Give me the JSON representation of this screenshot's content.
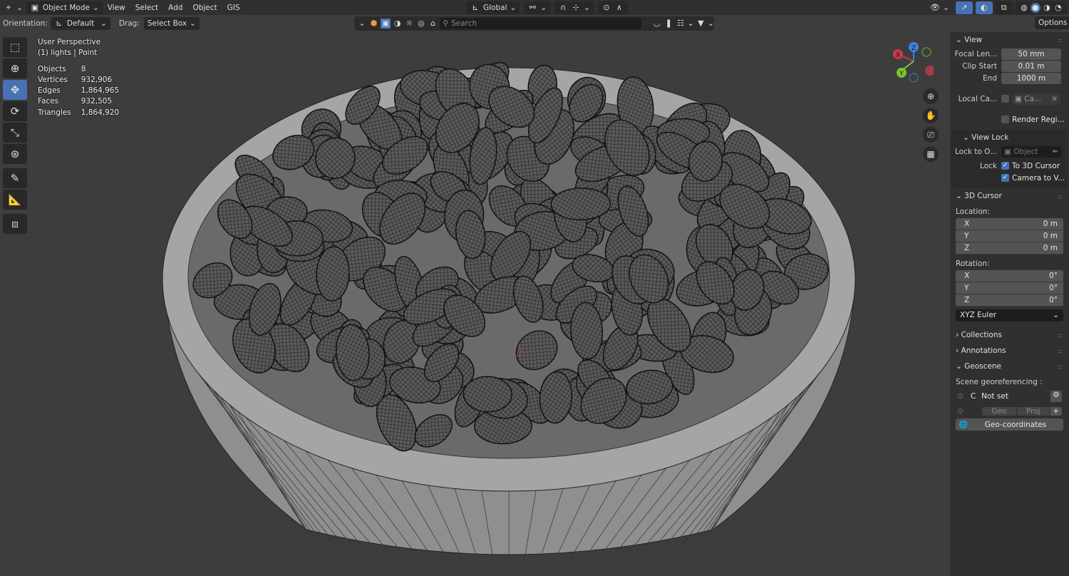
{
  "header": {
    "mode": "Object Mode",
    "menus": [
      "View",
      "Select",
      "Add",
      "Object",
      "GIS"
    ],
    "orientation_transform": "Global"
  },
  "tool_header": {
    "orientation_label": "Orientation:",
    "orientation_value": "Default",
    "drag_label": "Drag:",
    "drag_value": "Select Box",
    "search_placeholder": "Search",
    "options_label": "Options"
  },
  "overlay": {
    "view_name": "User Perspective",
    "context": "(1) lights | Point",
    "stats": [
      {
        "label": "Objects",
        "value": "8"
      },
      {
        "label": "Vertices",
        "value": "932,906"
      },
      {
        "label": "Edges",
        "value": "1,864,965"
      },
      {
        "label": "Faces",
        "value": "932,505"
      },
      {
        "label": "Triangles",
        "value": "1,864,920"
      }
    ]
  },
  "gizmo": {
    "x": "X",
    "y": "Y",
    "z": "Z",
    "colors": {
      "x": "#c7394a",
      "y": "#7ec42c",
      "z": "#3b84d9"
    }
  },
  "sidebar": {
    "view": {
      "title": "View",
      "focal_label": "Focal Len...",
      "focal": "50 mm",
      "clip_start_label": "Clip Start",
      "clip_start": "0.01 m",
      "end_label": "End",
      "end": "1000 m",
      "local_camera_label": "Local Ca...",
      "local_camera_value": "Ca...",
      "render_region_label": "Render Regi..."
    },
    "view_lock": {
      "title": "View Lock",
      "lock_to_label": "Lock to O...",
      "lock_to_placeholder": "Object",
      "lock_label": "Lock",
      "to_cursor": "To 3D Cursor",
      "camera_to_view": "Camera to V..."
    },
    "cursor": {
      "title": "3D Cursor",
      "location_label": "Location:",
      "location": [
        {
          "axis": "X",
          "value": "0 m"
        },
        {
          "axis": "Y",
          "value": "0 m"
        },
        {
          "axis": "Z",
          "value": "0 m"
        }
      ],
      "rotation_label": "Rotation:",
      "rotation": [
        {
          "axis": "X",
          "value": "0°"
        },
        {
          "axis": "Y",
          "value": "0°"
        },
        {
          "axis": "Z",
          "value": "0°"
        }
      ],
      "rotation_mode": "XYZ Euler"
    },
    "collections": "Collections",
    "annotations": "Annotations",
    "geoscene": {
      "title": "Geoscene",
      "georef_label": "Scene georeferencing :",
      "crs_prefix": "C",
      "crs_value": "Not set",
      "geo_btn": "Geo",
      "proj_btn": "Proj",
      "geocoords_btn": "Geo-coordinates"
    }
  },
  "colors": {
    "accent": "#4772b3",
    "viewport": "#3d3d3d",
    "panel": "#303030"
  }
}
